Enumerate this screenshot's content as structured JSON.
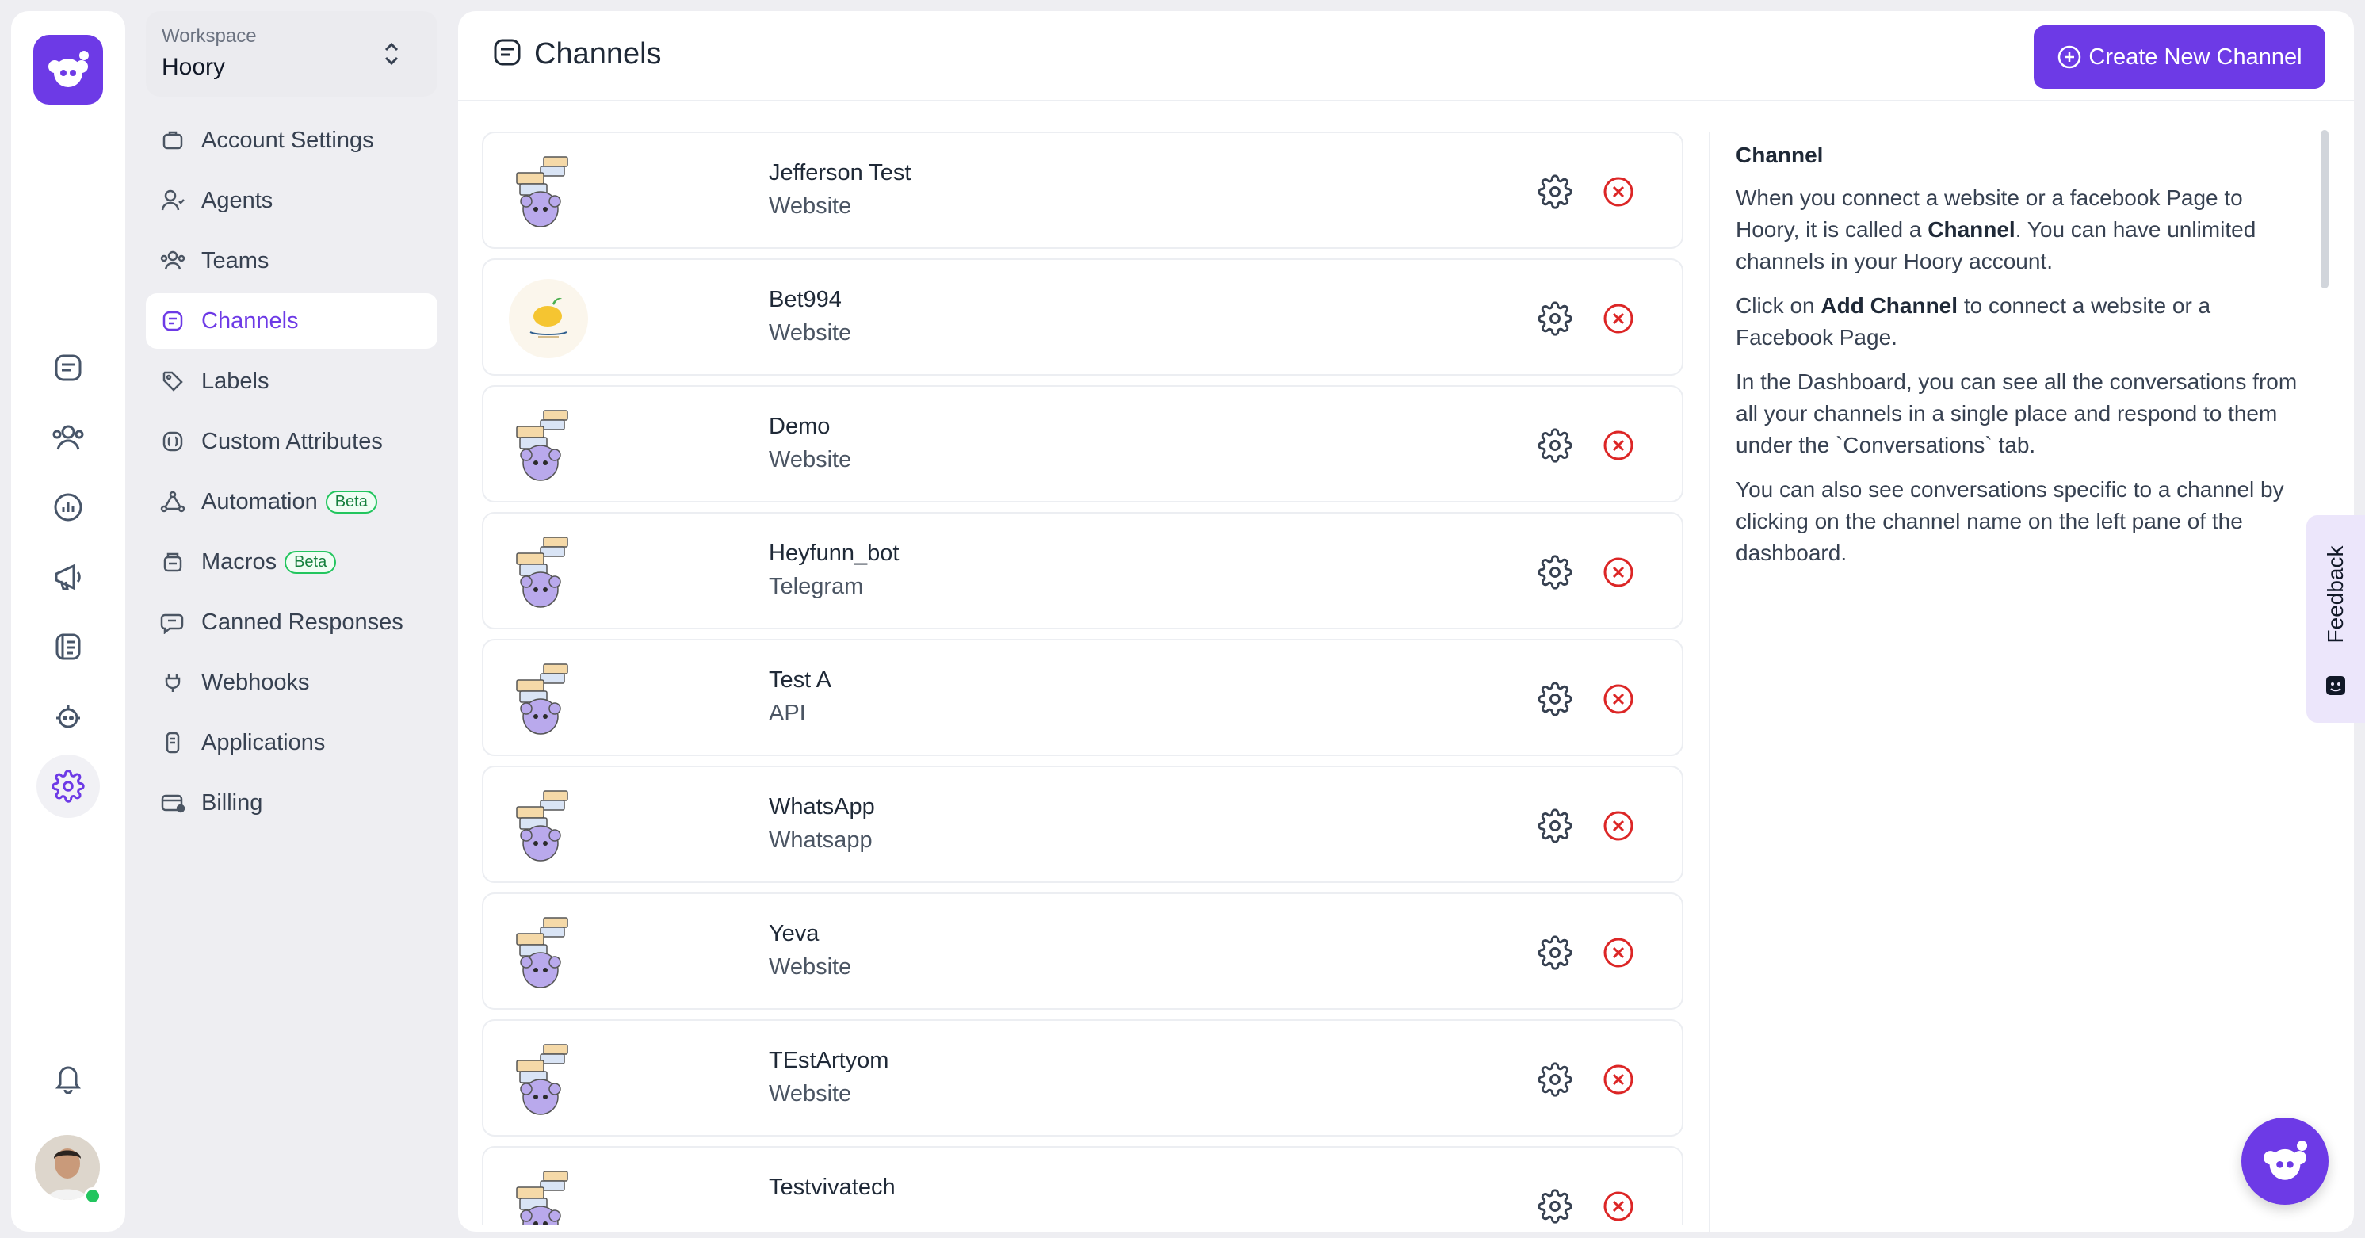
{
  "workspace": {
    "label": "Workspace",
    "name": "Hoory"
  },
  "menu": [
    {
      "label": "Account Settings",
      "icon": "briefcase-icon"
    },
    {
      "label": "Agents",
      "icon": "user-icon"
    },
    {
      "label": "Teams",
      "icon": "users-icon"
    },
    {
      "label": "Channels",
      "icon": "inbox-icon",
      "active": true
    },
    {
      "label": "Labels",
      "icon": "tag-icon"
    },
    {
      "label": "Custom Attributes",
      "icon": "code-icon"
    },
    {
      "label": "Automation",
      "icon": "flow-icon",
      "badge": "Beta"
    },
    {
      "label": "Macros",
      "icon": "macro-icon",
      "badge": "Beta"
    },
    {
      "label": "Canned Responses",
      "icon": "chat-icon"
    },
    {
      "label": "Webhooks",
      "icon": "plug-icon"
    },
    {
      "label": "Applications",
      "icon": "app-icon"
    },
    {
      "label": "Billing",
      "icon": "card-icon"
    }
  ],
  "header": {
    "title": "Channels",
    "create_label": "Create New Channel"
  },
  "channels": [
    {
      "name": "Jefferson Test",
      "type": "Website"
    },
    {
      "name": "Bet994",
      "type": "Website"
    },
    {
      "name": "Demo",
      "type": "Website"
    },
    {
      "name": "Heyfunn_bot",
      "type": "Telegram"
    },
    {
      "name": "Test A",
      "type": "API"
    },
    {
      "name": "WhatsApp",
      "type": "Whatsapp"
    },
    {
      "name": "Yeva",
      "type": "Website"
    },
    {
      "name": "TEstArtyom",
      "type": "Website"
    },
    {
      "name": "Testvivatech",
      "type": ""
    }
  ],
  "info": {
    "title": "Channel",
    "p1_a": "When you connect a website or a facebook Page to Hoory, it is called a ",
    "p1_b": "Channel",
    "p1_c": ". You can have unlimited channels in your Hoory account.",
    "p2_a": "Click on ",
    "p2_b": "Add Channel",
    "p2_c": " to connect a website or a Facebook Page.",
    "p3": "In the Dashboard, you can see all the conversations from all your channels in a single place and respond to them under the `Conversations` tab.",
    "p4": "You can also see conversations specific to a channel by clicking on the channel name on the left pane of the dashboard."
  },
  "feedback": {
    "label": "Feedback"
  },
  "colors": {
    "accent": "#6d3ae6",
    "danger": "#dc2626",
    "beta": "#22c55e"
  }
}
